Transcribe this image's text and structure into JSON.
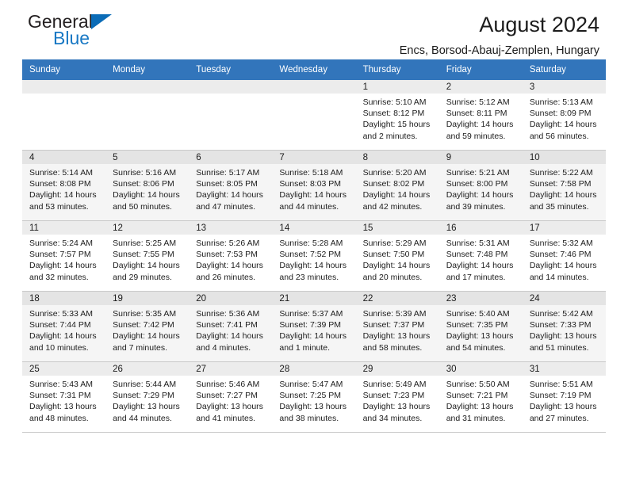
{
  "brand": {
    "name_part1": "General",
    "name_part2": "Blue",
    "triangle_icon": "blue-triangle-icon",
    "color_dark": "#231f20",
    "color_blue": "#1878c4"
  },
  "header": {
    "month_title": "August 2024",
    "location": "Encs, Borsod-Abauj-Zemplen, Hungary"
  },
  "calendar": {
    "header_bg": "#3275bb",
    "header_text_color": "#ffffff",
    "weekday_headers": [
      "Sunday",
      "Monday",
      "Tuesday",
      "Wednesday",
      "Thursday",
      "Friday",
      "Saturday"
    ],
    "weeks": [
      [
        {
          "day": "",
          "lines": []
        },
        {
          "day": "",
          "lines": []
        },
        {
          "day": "",
          "lines": []
        },
        {
          "day": "",
          "lines": []
        },
        {
          "day": "1",
          "lines": [
            "Sunrise: 5:10 AM",
            "Sunset: 8:12 PM",
            "Daylight: 15 hours and 2 minutes."
          ]
        },
        {
          "day": "2",
          "lines": [
            "Sunrise: 5:12 AM",
            "Sunset: 8:11 PM",
            "Daylight: 14 hours and 59 minutes."
          ]
        },
        {
          "day": "3",
          "lines": [
            "Sunrise: 5:13 AM",
            "Sunset: 8:09 PM",
            "Daylight: 14 hours and 56 minutes."
          ]
        }
      ],
      [
        {
          "day": "4",
          "lines": [
            "Sunrise: 5:14 AM",
            "Sunset: 8:08 PM",
            "Daylight: 14 hours and 53 minutes."
          ]
        },
        {
          "day": "5",
          "lines": [
            "Sunrise: 5:16 AM",
            "Sunset: 8:06 PM",
            "Daylight: 14 hours and 50 minutes."
          ]
        },
        {
          "day": "6",
          "lines": [
            "Sunrise: 5:17 AM",
            "Sunset: 8:05 PM",
            "Daylight: 14 hours and 47 minutes."
          ]
        },
        {
          "day": "7",
          "lines": [
            "Sunrise: 5:18 AM",
            "Sunset: 8:03 PM",
            "Daylight: 14 hours and 44 minutes."
          ]
        },
        {
          "day": "8",
          "lines": [
            "Sunrise: 5:20 AM",
            "Sunset: 8:02 PM",
            "Daylight: 14 hours and 42 minutes."
          ]
        },
        {
          "day": "9",
          "lines": [
            "Sunrise: 5:21 AM",
            "Sunset: 8:00 PM",
            "Daylight: 14 hours and 39 minutes."
          ]
        },
        {
          "day": "10",
          "lines": [
            "Sunrise: 5:22 AM",
            "Sunset: 7:58 PM",
            "Daylight: 14 hours and 35 minutes."
          ]
        }
      ],
      [
        {
          "day": "11",
          "lines": [
            "Sunrise: 5:24 AM",
            "Sunset: 7:57 PM",
            "Daylight: 14 hours and 32 minutes."
          ]
        },
        {
          "day": "12",
          "lines": [
            "Sunrise: 5:25 AM",
            "Sunset: 7:55 PM",
            "Daylight: 14 hours and 29 minutes."
          ]
        },
        {
          "day": "13",
          "lines": [
            "Sunrise: 5:26 AM",
            "Sunset: 7:53 PM",
            "Daylight: 14 hours and 26 minutes."
          ]
        },
        {
          "day": "14",
          "lines": [
            "Sunrise: 5:28 AM",
            "Sunset: 7:52 PM",
            "Daylight: 14 hours and 23 minutes."
          ]
        },
        {
          "day": "15",
          "lines": [
            "Sunrise: 5:29 AM",
            "Sunset: 7:50 PM",
            "Daylight: 14 hours and 20 minutes."
          ]
        },
        {
          "day": "16",
          "lines": [
            "Sunrise: 5:31 AM",
            "Sunset: 7:48 PM",
            "Daylight: 14 hours and 17 minutes."
          ]
        },
        {
          "day": "17",
          "lines": [
            "Sunrise: 5:32 AM",
            "Sunset: 7:46 PM",
            "Daylight: 14 hours and 14 minutes."
          ]
        }
      ],
      [
        {
          "day": "18",
          "lines": [
            "Sunrise: 5:33 AM",
            "Sunset: 7:44 PM",
            "Daylight: 14 hours and 10 minutes."
          ]
        },
        {
          "day": "19",
          "lines": [
            "Sunrise: 5:35 AM",
            "Sunset: 7:42 PM",
            "Daylight: 14 hours and 7 minutes."
          ]
        },
        {
          "day": "20",
          "lines": [
            "Sunrise: 5:36 AM",
            "Sunset: 7:41 PM",
            "Daylight: 14 hours and 4 minutes."
          ]
        },
        {
          "day": "21",
          "lines": [
            "Sunrise: 5:37 AM",
            "Sunset: 7:39 PM",
            "Daylight: 14 hours and 1 minute."
          ]
        },
        {
          "day": "22",
          "lines": [
            "Sunrise: 5:39 AM",
            "Sunset: 7:37 PM",
            "Daylight: 13 hours and 58 minutes."
          ]
        },
        {
          "day": "23",
          "lines": [
            "Sunrise: 5:40 AM",
            "Sunset: 7:35 PM",
            "Daylight: 13 hours and 54 minutes."
          ]
        },
        {
          "day": "24",
          "lines": [
            "Sunrise: 5:42 AM",
            "Sunset: 7:33 PM",
            "Daylight: 13 hours and 51 minutes."
          ]
        }
      ],
      [
        {
          "day": "25",
          "lines": [
            "Sunrise: 5:43 AM",
            "Sunset: 7:31 PM",
            "Daylight: 13 hours and 48 minutes."
          ]
        },
        {
          "day": "26",
          "lines": [
            "Sunrise: 5:44 AM",
            "Sunset: 7:29 PM",
            "Daylight: 13 hours and 44 minutes."
          ]
        },
        {
          "day": "27",
          "lines": [
            "Sunrise: 5:46 AM",
            "Sunset: 7:27 PM",
            "Daylight: 13 hours and 41 minutes."
          ]
        },
        {
          "day": "28",
          "lines": [
            "Sunrise: 5:47 AM",
            "Sunset: 7:25 PM",
            "Daylight: 13 hours and 38 minutes."
          ]
        },
        {
          "day": "29",
          "lines": [
            "Sunrise: 5:49 AM",
            "Sunset: 7:23 PM",
            "Daylight: 13 hours and 34 minutes."
          ]
        },
        {
          "day": "30",
          "lines": [
            "Sunrise: 5:50 AM",
            "Sunset: 7:21 PM",
            "Daylight: 13 hours and 31 minutes."
          ]
        },
        {
          "day": "31",
          "lines": [
            "Sunrise: 5:51 AM",
            "Sunset: 7:19 PM",
            "Daylight: 13 hours and 27 minutes."
          ]
        }
      ]
    ]
  }
}
